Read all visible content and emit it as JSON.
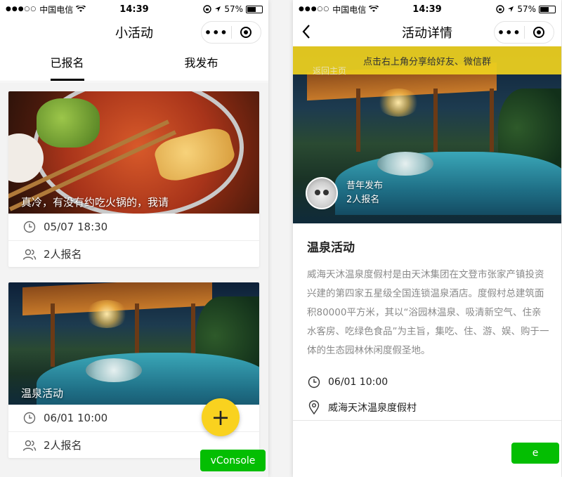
{
  "status_bar": {
    "carrier": "中国电信",
    "time": "14:39",
    "battery": "57%"
  },
  "left_screen": {
    "title": "小活动",
    "tabs": [
      {
        "label": "已报名",
        "active": true
      },
      {
        "label": "我发布",
        "active": false
      }
    ],
    "cards": [
      {
        "caption": "真冷，有没有约吃火锅的，我请",
        "datetime": "05/07 18:30",
        "signups": "2人报名"
      },
      {
        "caption": "温泉活动",
        "datetime": "06/01 10:00",
        "signups": "2人报名"
      }
    ],
    "fab_label": "+",
    "vconsole_label": "vConsole"
  },
  "right_screen": {
    "title": "活动详情",
    "banner_text": "点击右上角分享给好友、微信群",
    "return_home": "返回主页",
    "author_name": "昔年发布",
    "author_signups": "2人报名",
    "event_title": "温泉活动",
    "event_description": "威海天沐温泉度假村是由天沐集团在文登市张家产镇投资兴建的第四家五星级全国连锁温泉酒店。度假村总建筑面积80000平方米，其以“浴园林温泉、吸清新空气、住亲水客房、吃绿色食品”为主旨，集吃、住、游、娱、购于一体的生态园林休闲度假圣地。",
    "event_datetime": "06/01 10:00",
    "event_location": "威海天沐温泉度假村",
    "green_button_label": "e"
  },
  "colors": {
    "accent_yellow": "#f9d21f",
    "wechat_green": "#04be02",
    "banner_yellow": "#f0d21e"
  }
}
